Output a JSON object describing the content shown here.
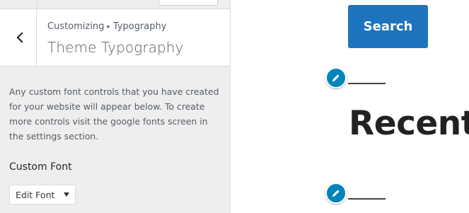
{
  "customizer": {
    "breadcrumb": {
      "part1": "Customizing",
      "separator": "▸",
      "part2": "Typography"
    },
    "section_title": "Theme Typography",
    "description": "Any custom font controls that you have created for your website will appear below. To create more controls visit the google fonts screen in the settings section.",
    "control_label": "Custom Font",
    "select_value": "Edit Font"
  },
  "preview": {
    "search_button_label": "Search",
    "widget_title": "Recent"
  },
  "icons": [
    "chevron-left-icon",
    "pencil-icon",
    "caret-down-icon"
  ],
  "colors": {
    "panel_background": "#eeeeee",
    "accent_button": "#1e73be",
    "edit_shortcut": "#0085ba",
    "text_muted": "#555d66"
  }
}
